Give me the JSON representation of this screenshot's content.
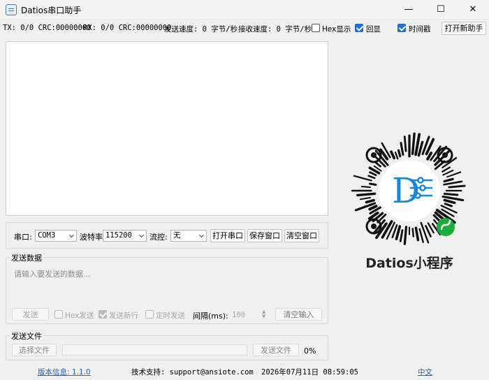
{
  "window": {
    "title": "Datios串口助手",
    "minimize_glyph": "—",
    "maximize_glyph": "☐",
    "close_glyph": "✕"
  },
  "status_bar": {
    "tx": "TX: 0/0 CRC:00000000",
    "rx": "RX: 0/0 CRC:00000000",
    "send_speed": "发送速度: 0 字节/秒",
    "recv_speed": "接收速度: 0 字节/秒",
    "hex_display": {
      "label": "Hex显示",
      "checked": false
    },
    "echo": {
      "label": "回显",
      "checked": true
    },
    "timestamp": {
      "label": "时间戳",
      "checked": true
    },
    "new_window_button": "打开新助手"
  },
  "controls": {
    "port_label": "串口:",
    "port_value": "COM3",
    "baud_label": "波特率",
    "baud_value": "115200",
    "flow_label": "流控:",
    "flow_value": "无",
    "open_button": "打开串口",
    "save_button": "保存窗口",
    "clear_button": "清空窗口"
  },
  "send_data": {
    "title": "发送数据",
    "placeholder": "请输入要发送的数据...",
    "send_button": "发送",
    "hex_send": {
      "label": "Hex发送",
      "checked": false
    },
    "newline": {
      "label": "发送新行",
      "checked": true
    },
    "timed_send": {
      "label": "定时发送",
      "checked": false
    },
    "interval_label": "间隔(ms):",
    "interval_value": "100",
    "clear_input_button": "清空输入"
  },
  "send_file": {
    "title": "发送文件",
    "choose_button": "选择文件",
    "send_button": "发送文件",
    "progress": "0%"
  },
  "qr": {
    "caption": "Datios小程序",
    "letter": "D"
  },
  "footer": {
    "version": "版本信息: 1.1.0",
    "support": "技术支持: support@ansiote.com",
    "datetime": "2026年07月11日 08:59:05",
    "language": "中文"
  },
  "colors": {
    "accent": "#1f6fd1",
    "qr_blue": "#1a86d8",
    "wechat_green": "#1aad3c"
  }
}
